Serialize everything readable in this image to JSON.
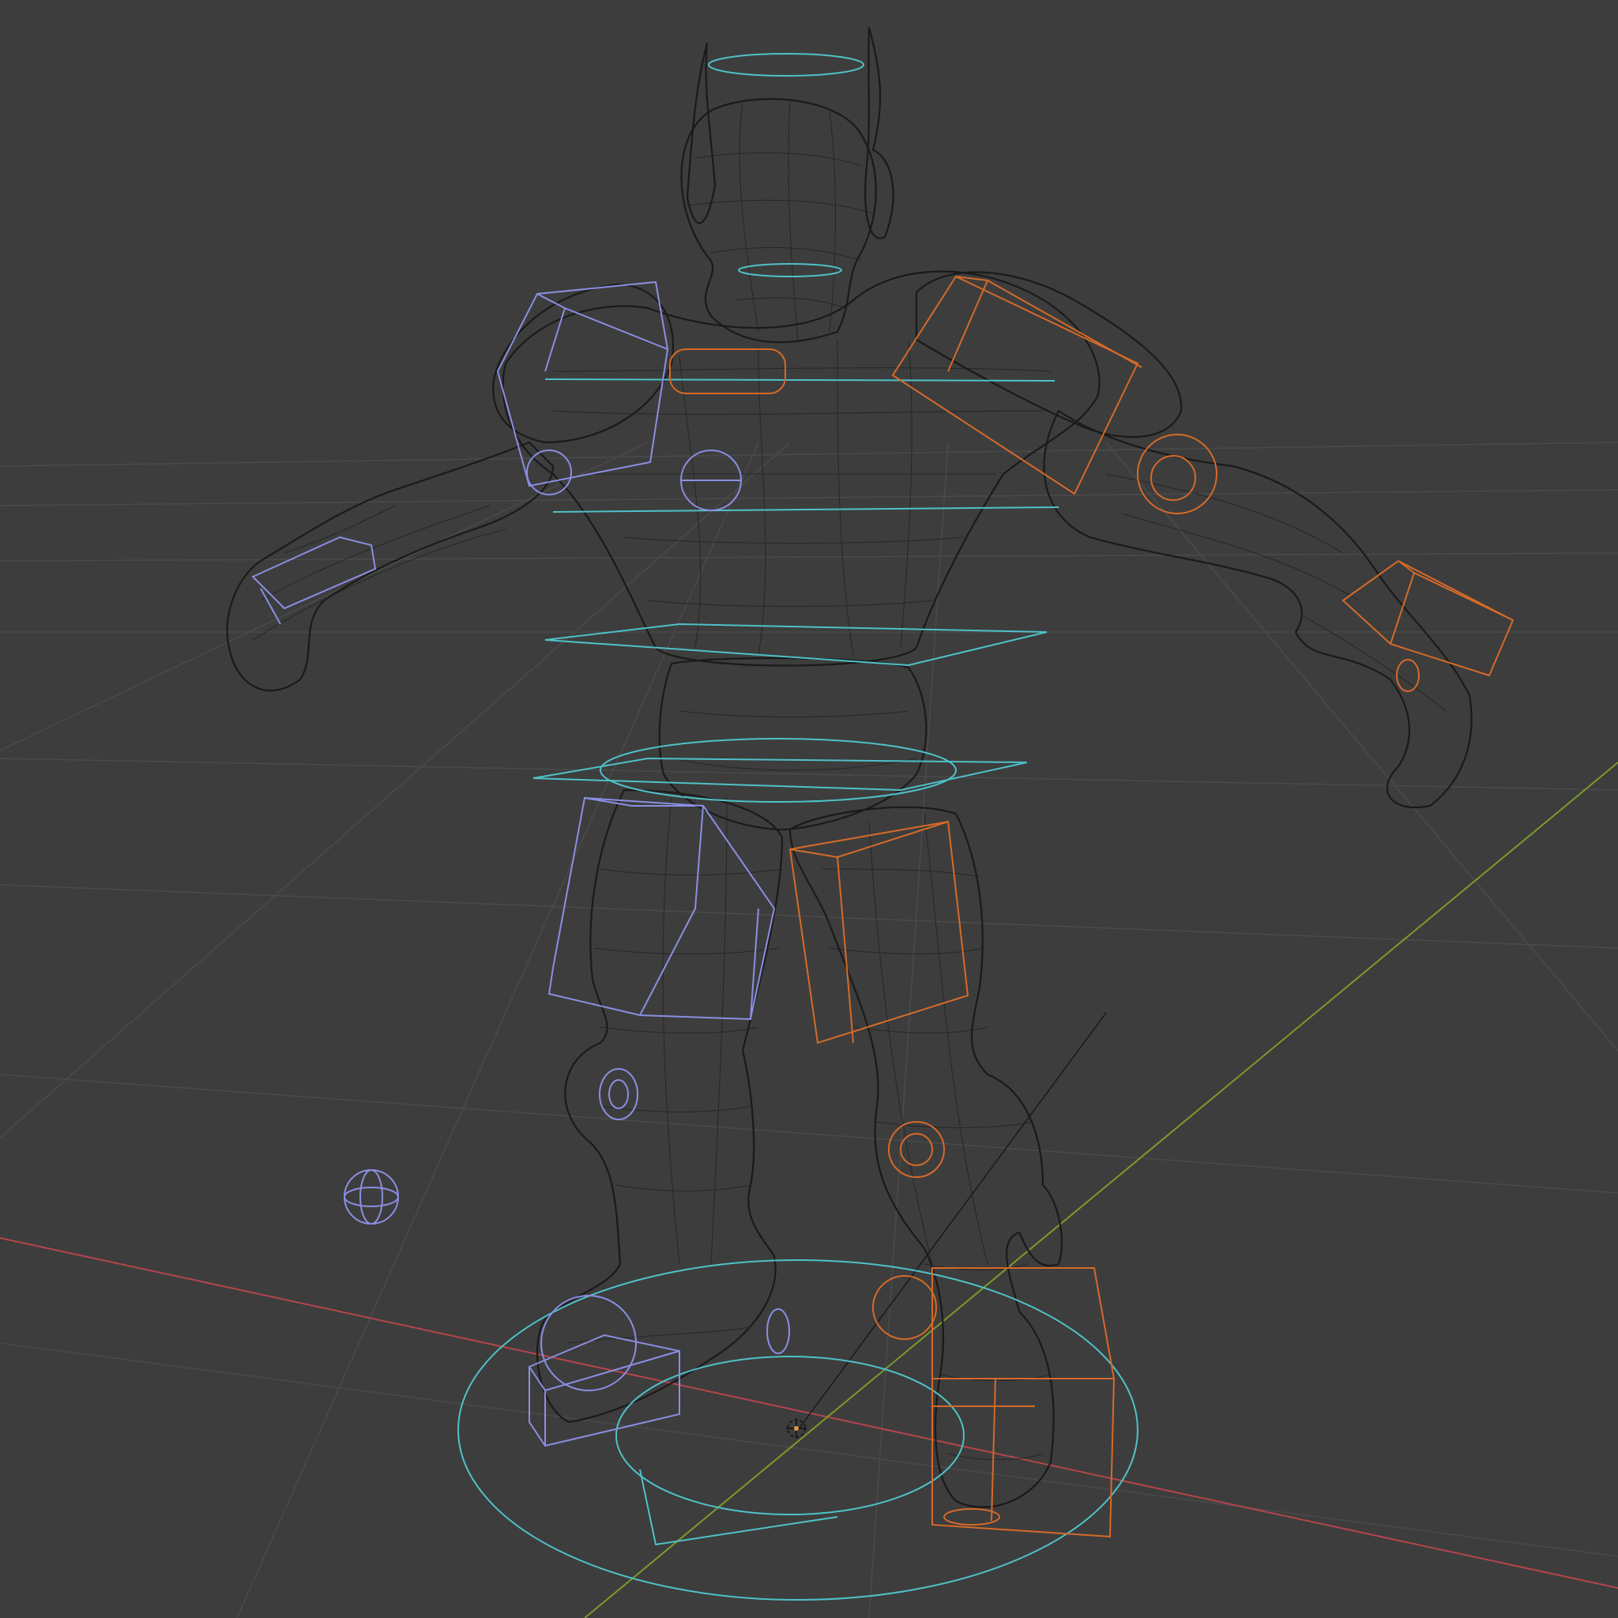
{
  "viewport": {
    "shading_mode": "wireframe",
    "background_color": "#3d3d3d",
    "grid_color": "#4a4a4a",
    "x_axis_color": "#b4454b",
    "y_axis_color": "#7c9a2b",
    "mesh_color": "#1a1a1a",
    "control_colors": {
      "center": "#4fc1c8",
      "left": "#8b8fe3",
      "right": "#d56a29"
    },
    "icons": [
      "3d-cursor-icon",
      "light-empty-icon"
    ]
  }
}
